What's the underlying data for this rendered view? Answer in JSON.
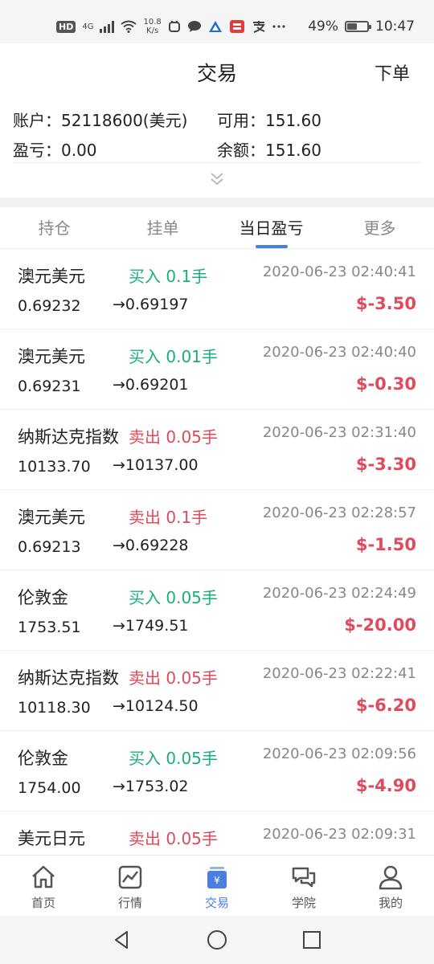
{
  "status_bar": {
    "hd": "HD",
    "network": "4G",
    "speed_value": "10.8",
    "speed_unit": "K/s",
    "battery_text": "49%",
    "battery_level": 0.49,
    "time": "10:47"
  },
  "header": {
    "title": "交易",
    "order_label": "下单"
  },
  "account": {
    "account_label": "账户：",
    "account_value": "52118600(美元)",
    "available_label": "可用：",
    "available_value": "151.60",
    "pnl_label": "盈亏：",
    "pnl_value": "0.00",
    "balance_label": "余额：",
    "balance_value": "151.60"
  },
  "tabs": [
    {
      "label": "持仓"
    },
    {
      "label": "挂单"
    },
    {
      "label": "当日盈亏",
      "active": true
    },
    {
      "label": "更多"
    }
  ],
  "trades": [
    {
      "name": "澳元美元",
      "side": "买入 0.1手",
      "side_type": "buy",
      "time": "2020-06-23 02:40:41",
      "open": "0.69232",
      "close": "→0.69197",
      "pnl": "$-3.50"
    },
    {
      "name": "澳元美元",
      "side": "买入 0.01手",
      "side_type": "buy",
      "time": "2020-06-23 02:40:40",
      "open": "0.69231",
      "close": "→0.69201",
      "pnl": "$-0.30"
    },
    {
      "name": "纳斯达克指数",
      "side": "卖出 0.05手",
      "side_type": "sell",
      "time": "2020-06-23 02:31:40",
      "open": "10133.70",
      "close": "→10137.00",
      "pnl": "$-3.30"
    },
    {
      "name": "澳元美元",
      "side": "卖出 0.1手",
      "side_type": "sell",
      "time": "2020-06-23 02:28:57",
      "open": "0.69213",
      "close": "→0.69228",
      "pnl": "$-1.50"
    },
    {
      "name": "伦敦金",
      "side": "买入 0.05手",
      "side_type": "buy",
      "time": "2020-06-23 02:24:49",
      "open": "1753.51",
      "close": "→1749.51",
      "pnl": "$-20.00"
    },
    {
      "name": "纳斯达克指数",
      "side": "卖出 0.05手",
      "side_type": "sell",
      "time": "2020-06-23 02:22:41",
      "open": "10118.30",
      "close": "→10124.50",
      "pnl": "$-6.20"
    },
    {
      "name": "伦敦金",
      "side": "买入 0.05手",
      "side_type": "buy",
      "time": "2020-06-23 02:09:56",
      "open": "1754.00",
      "close": "→1753.02",
      "pnl": "$-4.90"
    },
    {
      "name": "美元日元",
      "side": "卖出 0.05手",
      "side_type": "sell",
      "time": "2020-06-23 02:09:31",
      "open": "",
      "close": "",
      "pnl": ""
    }
  ],
  "bottom_nav": [
    {
      "label": "首页",
      "icon": "home-icon"
    },
    {
      "label": "行情",
      "icon": "chart-icon"
    },
    {
      "label": "交易",
      "icon": "trade-icon",
      "active": true
    },
    {
      "label": "学院",
      "icon": "chat-icon"
    },
    {
      "label": "我的",
      "icon": "user-icon"
    }
  ],
  "colors": {
    "accent": "#4a7fe0",
    "buy": "#1aaf7a",
    "sell": "#e14a5a",
    "loss": "#e14a5a"
  }
}
